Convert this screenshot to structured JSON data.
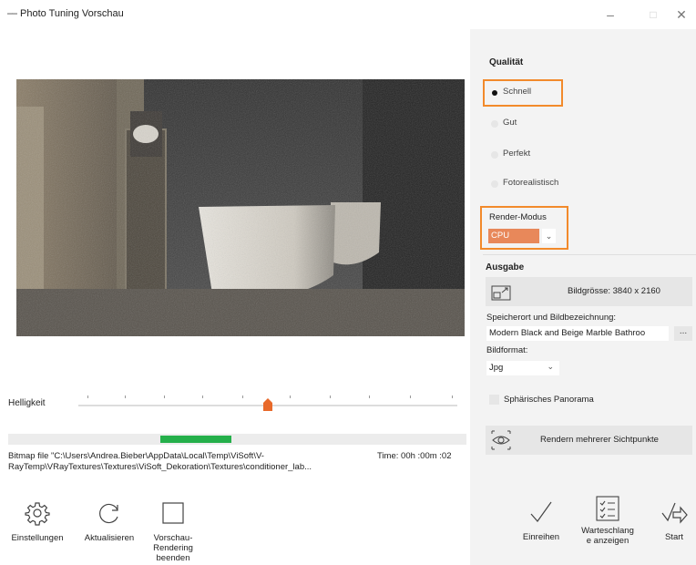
{
  "window": {
    "title": "Photo Tuning Vorschau",
    "minimize_glyph": "–",
    "maximize_glyph": "□",
    "close_glyph": "✕"
  },
  "preview": {
    "brightness_label": "Helligkeit",
    "brightness_value": 0.49,
    "progress": {
      "start": 0.33,
      "end": 0.49
    },
    "status_text": "Bitmap file \"C:\\Users\\Andrea.Bieber\\AppData\\Local\\Temp\\ViSoft\\V-RayTemp\\VRayTextures\\Textures\\ViSoft_Dekoration\\Textures\\conditioner_lab...",
    "time_text": "Time: 00h :00m :02"
  },
  "toolbar": {
    "settings_label": "Einstellungen",
    "refresh_label": "Aktualisieren",
    "stop_label": "Vorschau-\nRendering\nbeenden",
    "enqueue_label": "Einreihen",
    "queue_label": "Warteschlang\ne anzeigen",
    "start_label": "Start"
  },
  "quality": {
    "title": "Qualität",
    "options": [
      {
        "label": "Schnell",
        "selected": true
      },
      {
        "label": "Gut",
        "selected": false
      },
      {
        "label": "Perfekt",
        "selected": false
      },
      {
        "label": "Fotorealistisch",
        "selected": false
      }
    ],
    "render_mode_label": "Render-Modus",
    "render_mode_value": "CPU",
    "highlight_color": "#f28a2b"
  },
  "output": {
    "title": "Ausgabe",
    "image_size_label": "Bildgrösse: 3840 x 2160",
    "location_label": "Speicherort und Bildbezeichnung:",
    "location_value": "Modern Black and Beige Marble Bathroo",
    "more_label": "...",
    "format_label": "Bildformat:",
    "format_value": "Jpg",
    "panorama_label": "Sphärisches Panorama",
    "multi_view_label": "Rendern mehrerer Sichtpunkte"
  },
  "colors": {
    "progress_fill": "#25b04b",
    "slider_thumb": "#e8692a",
    "cpu_select": "#e8885a",
    "panel_bg": "#f3f3f3"
  }
}
